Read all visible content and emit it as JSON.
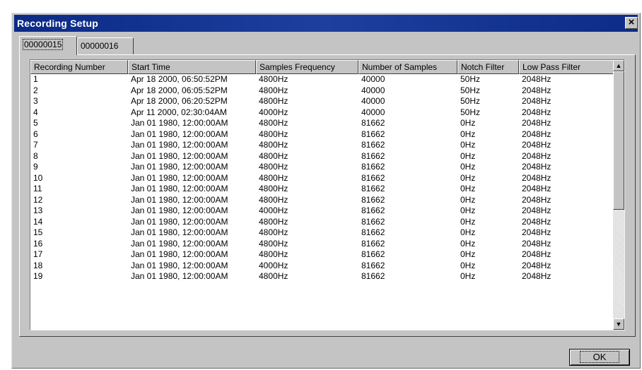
{
  "window": {
    "title": "Recording Setup",
    "close_glyph": "×"
  },
  "tabs": [
    {
      "label": "00000015",
      "active": true
    },
    {
      "label": "00000016",
      "active": false
    }
  ],
  "table": {
    "columns": [
      "Recording Number",
      "Start Time",
      "Samples Frequency",
      "Number of Samples",
      "Notch Filter",
      "Low Pass Filter"
    ],
    "rows": [
      [
        "1",
        "Apr 18 2000, 06:50:52PM",
        "4800Hz",
        "40000",
        "50Hz",
        "2048Hz"
      ],
      [
        "2",
        "Apr 18 2000, 06:05:52PM",
        "4800Hz",
        "40000",
        "50Hz",
        "2048Hz"
      ],
      [
        "3",
        "Apr 18 2000, 06:20:52PM",
        "4800Hz",
        "40000",
        "50Hz",
        "2048Hz"
      ],
      [
        "4",
        "Apr 11 2000, 02:30:04AM",
        "4000Hz",
        "40000",
        "50Hz",
        "2048Hz"
      ],
      [
        "5",
        "Jan 01 1980, 12:00:00AM",
        "4800Hz",
        "81662",
        "0Hz",
        "2048Hz"
      ],
      [
        "6",
        "Jan 01 1980, 12:00:00AM",
        "4800Hz",
        "81662",
        "0Hz",
        "2048Hz"
      ],
      [
        "7",
        "Jan 01 1980, 12:00:00AM",
        "4800Hz",
        "81662",
        "0Hz",
        "2048Hz"
      ],
      [
        "8",
        "Jan 01 1980, 12:00:00AM",
        "4800Hz",
        "81662",
        "0Hz",
        "2048Hz"
      ],
      [
        "9",
        "Jan 01 1980, 12:00:00AM",
        "4800Hz",
        "81662",
        "0Hz",
        "2048Hz"
      ],
      [
        "10",
        "Jan 01 1980, 12:00:00AM",
        "4800Hz",
        "81662",
        "0Hz",
        "2048Hz"
      ],
      [
        "11",
        "Jan 01 1980, 12:00:00AM",
        "4800Hz",
        "81662",
        "0Hz",
        "2048Hz"
      ],
      [
        "12",
        "Jan 01 1980, 12:00:00AM",
        "4800Hz",
        "81662",
        "0Hz",
        "2048Hz"
      ],
      [
        "13",
        "Jan 01 1980, 12:00:00AM",
        "4000Hz",
        "81662",
        "0Hz",
        "2048Hz"
      ],
      [
        "14",
        "Jan 01 1980, 12:00:00AM",
        "4800Hz",
        "81662",
        "0Hz",
        "2048Hz"
      ],
      [
        "15",
        "Jan 01 1980, 12:00:00AM",
        "4800Hz",
        "81662",
        "0Hz",
        "2048Hz"
      ],
      [
        "16",
        "Jan 01 1980, 12:00:00AM",
        "4800Hz",
        "81662",
        "0Hz",
        "2048Hz"
      ],
      [
        "17",
        "Jan 01 1980, 12:00:00AM",
        "4800Hz",
        "81662",
        "0Hz",
        "2048Hz"
      ],
      [
        "18",
        "Jan 01 1980, 12:00:00AM",
        "4000Hz",
        "81662",
        "0Hz",
        "2048Hz"
      ],
      [
        "19",
        "Jan 01 1980, 12:00:00AM",
        "4800Hz",
        "81662",
        "0Hz",
        "2048Hz"
      ]
    ]
  },
  "scrollbar": {
    "up_glyph": "▲",
    "down_glyph": "▼"
  },
  "buttons": {
    "ok_label": "OK"
  },
  "colors": {
    "titlebar": "#0b2a86",
    "dialog_face": "#c4c4c4",
    "list_background": "#ffffff"
  }
}
